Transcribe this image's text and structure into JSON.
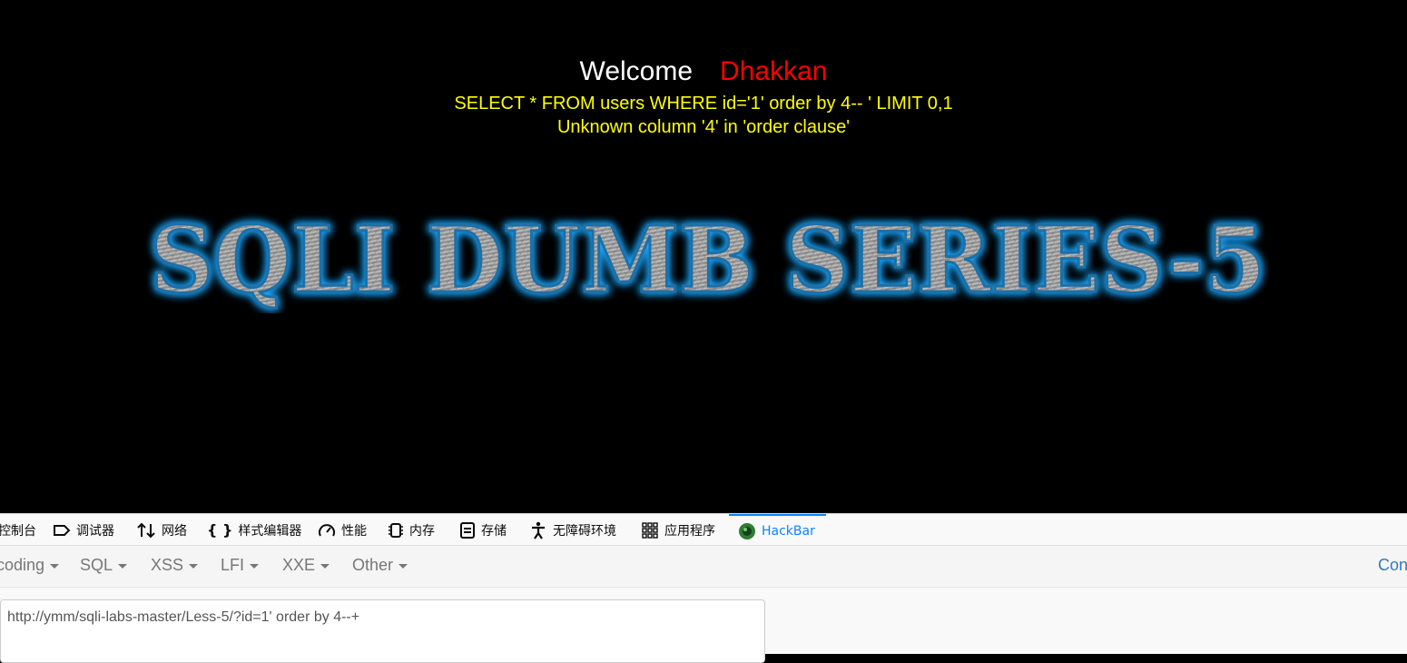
{
  "page": {
    "welcome": "Welcome",
    "username": "Dhakkan",
    "query": "SELECT * FROM users WHERE id='1' order by 4-- ' LIMIT 0,1",
    "error": "Unknown column '4' in 'order clause'",
    "banner_text": "SQLI DUMB SERIES-5",
    "colors": {
      "background": "#000000",
      "username": "#ff0000",
      "query": "#ffff00",
      "banner_glow": "#1ea7ff"
    }
  },
  "devtools": {
    "tabs": [
      {
        "label": "控制台",
        "icon": "console-icon"
      },
      {
        "label": "调试器",
        "icon": "debugger-icon"
      },
      {
        "label": "网络",
        "icon": "network-icon"
      },
      {
        "label": "样式编辑器",
        "icon": "style-editor-icon"
      },
      {
        "label": "性能",
        "icon": "performance-icon"
      },
      {
        "label": "内存",
        "icon": "memory-icon"
      },
      {
        "label": "存储",
        "icon": "storage-icon"
      },
      {
        "label": "无障碍环境",
        "icon": "accessibility-icon"
      },
      {
        "label": "应用程序",
        "icon": "application-icon"
      },
      {
        "label": "HackBar",
        "icon": "hackbar-icon",
        "selected": true
      }
    ]
  },
  "hackbar": {
    "menu": [
      "coding",
      "SQL",
      "XSS",
      "LFI",
      "XXE",
      "Other"
    ],
    "right_link": "Con",
    "url": "http://ymm/sqli-labs-master/Less-5/?id=1' order by 4--+"
  }
}
